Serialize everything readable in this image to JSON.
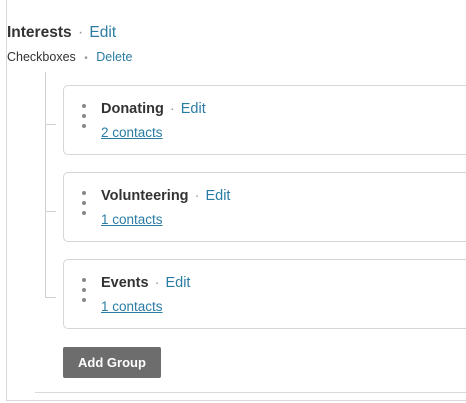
{
  "header": {
    "title": "Interests",
    "separator": "·",
    "edit_label": "Edit",
    "type_label": "Checkboxes",
    "type_separator": "•",
    "delete_label": "Delete"
  },
  "groups": [
    {
      "name": "Donating",
      "separator": "·",
      "edit_label": "Edit",
      "contacts_label": "2 contacts"
    },
    {
      "name": "Volunteering",
      "separator": "·",
      "edit_label": "Edit",
      "contacts_label": "1 contacts"
    },
    {
      "name": "Events",
      "separator": "·",
      "edit_label": "Edit",
      "contacts_label": "1 contacts"
    }
  ],
  "add_group_label": "Add Group",
  "colors": {
    "link": "#2a7ca3",
    "button_bg": "#6d6d6d",
    "border": "#d6d6d6"
  },
  "icons": {
    "drag_handle": "vertical-dots-icon"
  }
}
